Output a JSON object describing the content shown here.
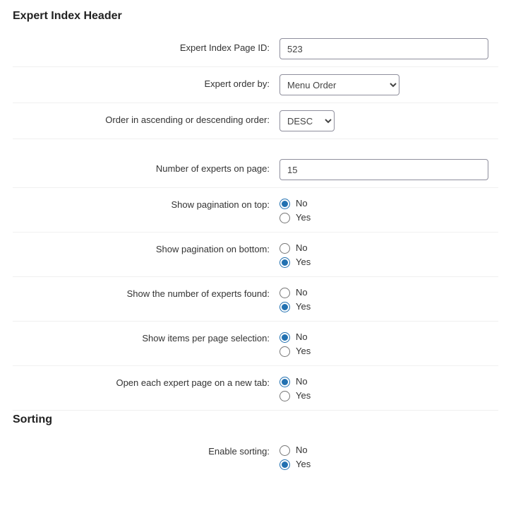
{
  "sections": {
    "header": "Expert Index Header",
    "sorting": "Sorting"
  },
  "fields": {
    "page_id": {
      "label": "Expert Index Page ID:",
      "value": "523"
    },
    "order_by": {
      "label": "Expert order by:",
      "selected": "Menu Order"
    },
    "order_dir": {
      "label": "Order in ascending or descending order:",
      "selected": "DESC"
    },
    "per_page": {
      "label": "Number of experts on page:",
      "value": "15"
    },
    "pag_top": {
      "label": "Show pagination on top:",
      "selected": "no"
    },
    "pag_bottom": {
      "label": "Show pagination on bottom:",
      "selected": "yes"
    },
    "count_found": {
      "label": "Show the number of experts found:",
      "selected": "yes"
    },
    "items_sel": {
      "label": "Show items per page selection:",
      "selected": "no"
    },
    "new_tab": {
      "label": "Open each expert page on a new tab:",
      "selected": "no"
    },
    "enable_sort": {
      "label": "Enable sorting:",
      "selected": "yes"
    }
  },
  "options": {
    "no": "No",
    "yes": "Yes"
  }
}
